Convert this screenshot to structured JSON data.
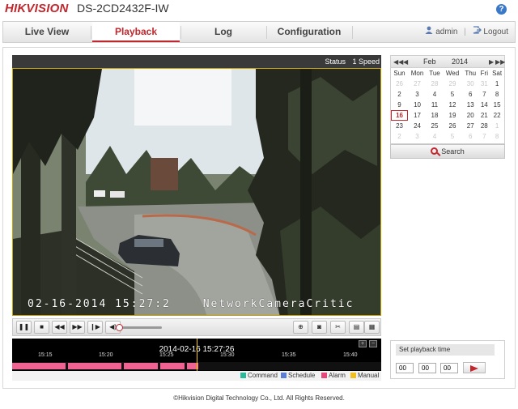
{
  "header": {
    "brand": "HIKVISION",
    "model": "DS-2CD2432F-IW",
    "help_glyph": "?"
  },
  "nav": {
    "tabs": [
      {
        "label": "Live View",
        "active": false
      },
      {
        "label": "Playback",
        "active": true
      },
      {
        "label": "Log",
        "active": false
      },
      {
        "label": "Configuration",
        "active": false
      }
    ],
    "user": "admin",
    "separator": "|",
    "logout": "Logout"
  },
  "video": {
    "status_label": "Status",
    "status_value": "1 Speed",
    "osd_time": "02-16-2014 15:27:2",
    "osd_name": "NetworkCameraCritic"
  },
  "controls": {
    "buttons": [
      "pause",
      "stop",
      "slow-down",
      "speed-up",
      "frame-forward",
      "audio",
      "zoom",
      "capture",
      "clip",
      "download",
      "download-all"
    ]
  },
  "timeline": {
    "current_time": "2014-02-16 15:27:26",
    "ticks": [
      "15:15",
      "15:20",
      "15:25",
      "15:30",
      "15:35",
      "15:40"
    ],
    "legend": [
      {
        "label": "Command",
        "color": "#2eb89a"
      },
      {
        "label": "Schedule",
        "color": "#5b7fd6"
      },
      {
        "label": "Alarm",
        "color": "#e8457a"
      },
      {
        "label": "Manual",
        "color": "#f0c020"
      }
    ],
    "record_color": "#f06292"
  },
  "calendar": {
    "prev_year": "◀◀",
    "prev_month": "◀",
    "month": "Feb",
    "year": "2014",
    "next_month": "▶",
    "next_year": "▶▶",
    "weekdays": [
      "Sun",
      "Mon",
      "Tue",
      "Wed",
      "Thu",
      "Fri",
      "Sat"
    ],
    "weeks": [
      [
        "26",
        "27",
        "28",
        "29",
        "30",
        "31",
        "1"
      ],
      [
        "2",
        "3",
        "4",
        "5",
        "6",
        "7",
        "8"
      ],
      [
        "9",
        "10",
        "11",
        "12",
        "13",
        "14",
        "15"
      ],
      [
        "16",
        "17",
        "18",
        "19",
        "20",
        "21",
        "22"
      ],
      [
        "23",
        "24",
        "25",
        "26",
        "27",
        "28",
        "1"
      ],
      [
        "2",
        "3",
        "4",
        "5",
        "6",
        "7",
        "8"
      ]
    ],
    "selected": "16",
    "search_label": "Search"
  },
  "playback_time": {
    "title": "Set playback time",
    "hh": "00",
    "mm": "00",
    "ss": "00"
  },
  "footer": {
    "copyright": "©Hikvision Digital Technology Co., Ltd. All Rights Reserved."
  }
}
